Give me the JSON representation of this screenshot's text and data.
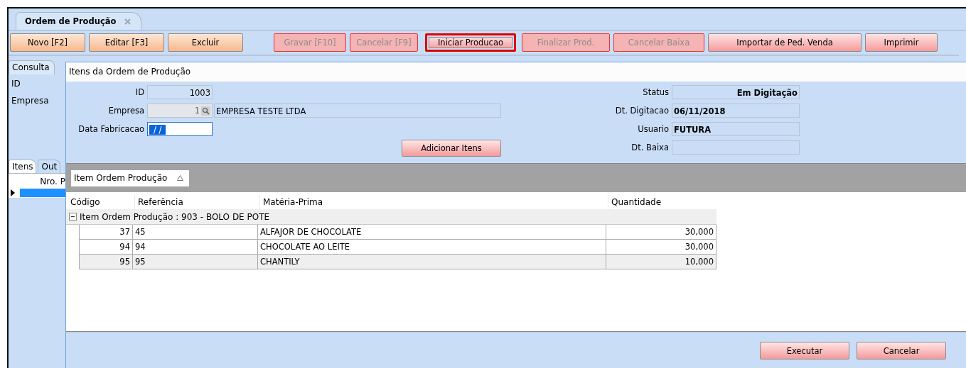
{
  "document_tab": {
    "title": "Ordem de Produção"
  },
  "toolbar": [
    {
      "label": "Novo [F2]",
      "kind": "record",
      "disabled": false,
      "highlighted": false
    },
    {
      "label": "Editar [F3]",
      "kind": "record",
      "disabled": false,
      "highlighted": false
    },
    {
      "label": "Excluir",
      "kind": "record",
      "disabled": false,
      "highlighted": false
    },
    {
      "label": "Gravar [F10]",
      "kind": "process",
      "disabled": true,
      "highlighted": false
    },
    {
      "label": "Cancelar [F9]",
      "kind": "process",
      "disabled": true,
      "highlighted": false
    },
    {
      "label": "Iniciar Producao",
      "kind": "process",
      "disabled": false,
      "highlighted": true
    },
    {
      "label": "Finalizar Prod.",
      "kind": "process",
      "disabled": true,
      "highlighted": false
    },
    {
      "label": "Cancelar Baixa",
      "kind": "process",
      "disabled": true,
      "highlighted": false
    },
    {
      "label": "Importar de Ped. Venda",
      "kind": "process",
      "disabled": false,
      "highlighted": false
    },
    {
      "label": "Imprimir",
      "kind": "process",
      "disabled": false,
      "highlighted": false
    }
  ],
  "background_form": {
    "tab": "Consulta",
    "labels": [
      "ID",
      "Empresa"
    ],
    "sub_tabs": [
      {
        "label": "Itens",
        "selected": true
      },
      {
        "label": "Out",
        "selected": false
      }
    ],
    "grid_column": "Nro. P"
  },
  "dialog": {
    "title": "Itens da Ordem de Produção",
    "fields_left": [
      {
        "label": "ID",
        "kind": "readonly",
        "value": "1003"
      },
      {
        "label": "Empresa",
        "kind": "lookup",
        "value": "1",
        "description": "EMPRESA TESTE LTDA"
      },
      {
        "label": "Data Fabricacao",
        "kind": "date",
        "value": "/ /",
        "focused": true
      }
    ],
    "add_button": "Adicionar Itens",
    "fields_right": [
      {
        "label": "Status",
        "kind": "status",
        "value": "Em Digitação"
      },
      {
        "label": "Dt. Digitacao",
        "kind": "text",
        "value": "06/11/2018"
      },
      {
        "label": "Usuario",
        "kind": "text",
        "value": "FUTURA"
      },
      {
        "label": "Dt. Baixa",
        "kind": "text"
      }
    ],
    "group_chip": "Item Ordem Produção",
    "columns": [
      "Código",
      "Referência",
      "Matéria-Prima",
      "Quantidade"
    ],
    "group_row": {
      "label": "Item Ordem Produção : 903 - BOLO DE POTE",
      "expanded": true
    },
    "rows": [
      {
        "cells": [
          "37",
          "45",
          "ALFAJOR DE CHOCOLATE",
          "30,000"
        ],
        "selected": false
      },
      {
        "cells": [
          "94",
          "94",
          "CHOCOLATE AO LEITE",
          "30,000"
        ],
        "selected": false
      },
      {
        "cells": [
          "95",
          "95",
          "CHANTILY",
          "10,000"
        ],
        "selected": true
      }
    ],
    "buttons": [
      "Executar",
      "Cancelar"
    ]
  }
}
